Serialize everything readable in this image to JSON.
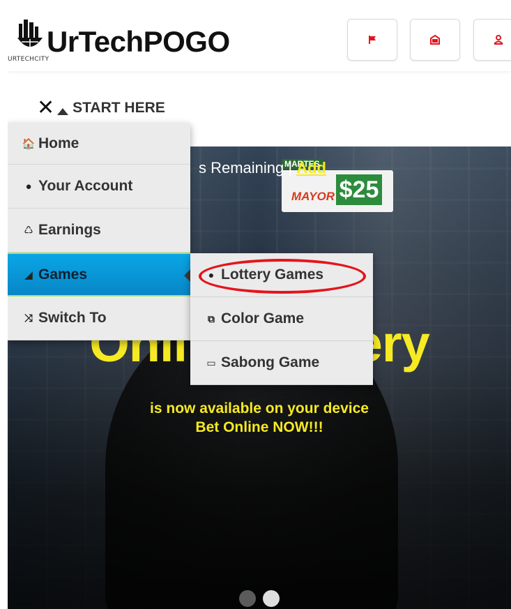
{
  "brand": {
    "name": "UrTechPOGO",
    "subtitle": "URTECHCITY"
  },
  "header_buttons": [
    {
      "icon": "flag-icon",
      "color": "#e4141c"
    },
    {
      "icon": "box-icon",
      "color": "#e4141c"
    },
    {
      "icon": "user-icon",
      "color": "#e4141c"
    }
  ],
  "menu": {
    "toggle_label": "START HERE",
    "items": [
      {
        "label": "Home",
        "icon": "home-icon",
        "glyph": "🏠"
      },
      {
        "label": "Your Account",
        "icon": "account-icon",
        "glyph": "●"
      },
      {
        "label": "Earnings",
        "icon": "earnings-icon",
        "glyph": "♺"
      },
      {
        "label": "Games",
        "icon": "games-icon",
        "glyph": "◢",
        "active": true
      },
      {
        "label": "Switch To",
        "icon": "shuffle-icon",
        "glyph": "⤨"
      }
    ]
  },
  "submenu": {
    "items": [
      {
        "label": "Lottery Games",
        "icon": "dot-icon",
        "glyph": "●",
        "highlighted": true
      },
      {
        "label": "Color Game",
        "icon": "color-icon",
        "glyph": "⧉"
      },
      {
        "label": "Sabong Game",
        "icon": "ticket-icon",
        "glyph": "▭"
      }
    ]
  },
  "hero": {
    "remaining_text": "s Remaining | ",
    "add_link": "Add",
    "price_tag_day": "MARTES",
    "price_tag_word": "MAYOR",
    "price_tag_amount": "$25",
    "title": "Online Lottery",
    "line1": "is now available on your device",
    "line2": "Bet Online NOW!!!"
  },
  "colors": {
    "accent_yellow": "#f6ea23",
    "menu_active": "#0aa6e6",
    "highlight_red": "#e4141c"
  }
}
